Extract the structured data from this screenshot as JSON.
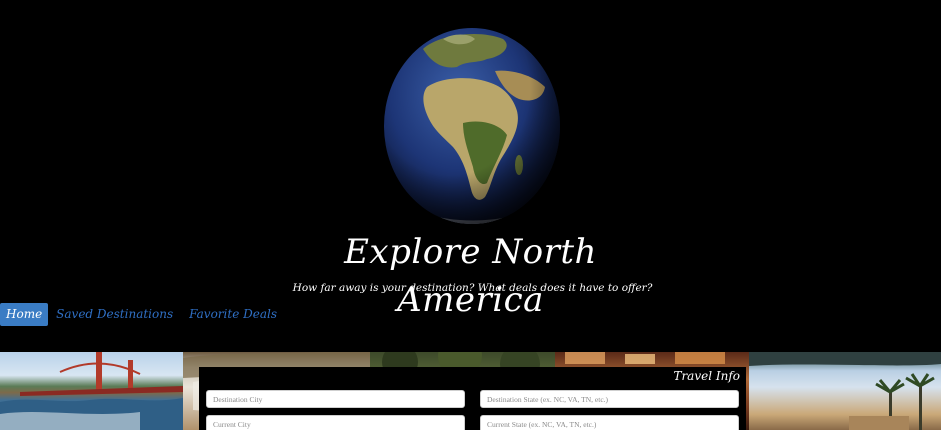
{
  "site": {
    "title": "Explore North America",
    "tagline": "How far away is your destination? What deals does it have to offer?"
  },
  "nav": {
    "items": [
      {
        "label": "Home",
        "active": true
      },
      {
        "label": "Saved Destinations",
        "active": false
      },
      {
        "label": "Favorite Deals",
        "active": false
      }
    ]
  },
  "travel_panel": {
    "title": "Travel Info",
    "fields": {
      "destination_city": {
        "placeholder": "Destination City",
        "value": ""
      },
      "destination_state": {
        "placeholder": "Destination State (ex. NC, VA, TN, etc.)",
        "value": ""
      },
      "current_city": {
        "placeholder": "Current City",
        "value": ""
      },
      "current_state": {
        "placeholder": "Current State (ex. NC, VA, TN, etc.)",
        "value": ""
      }
    }
  },
  "theme": {
    "background": "#000000",
    "nav_active_bg": "#3a7cc4",
    "nav_link": "#2f6fc4",
    "text": "#ffffff"
  },
  "icons": [
    "globe-icon"
  ]
}
